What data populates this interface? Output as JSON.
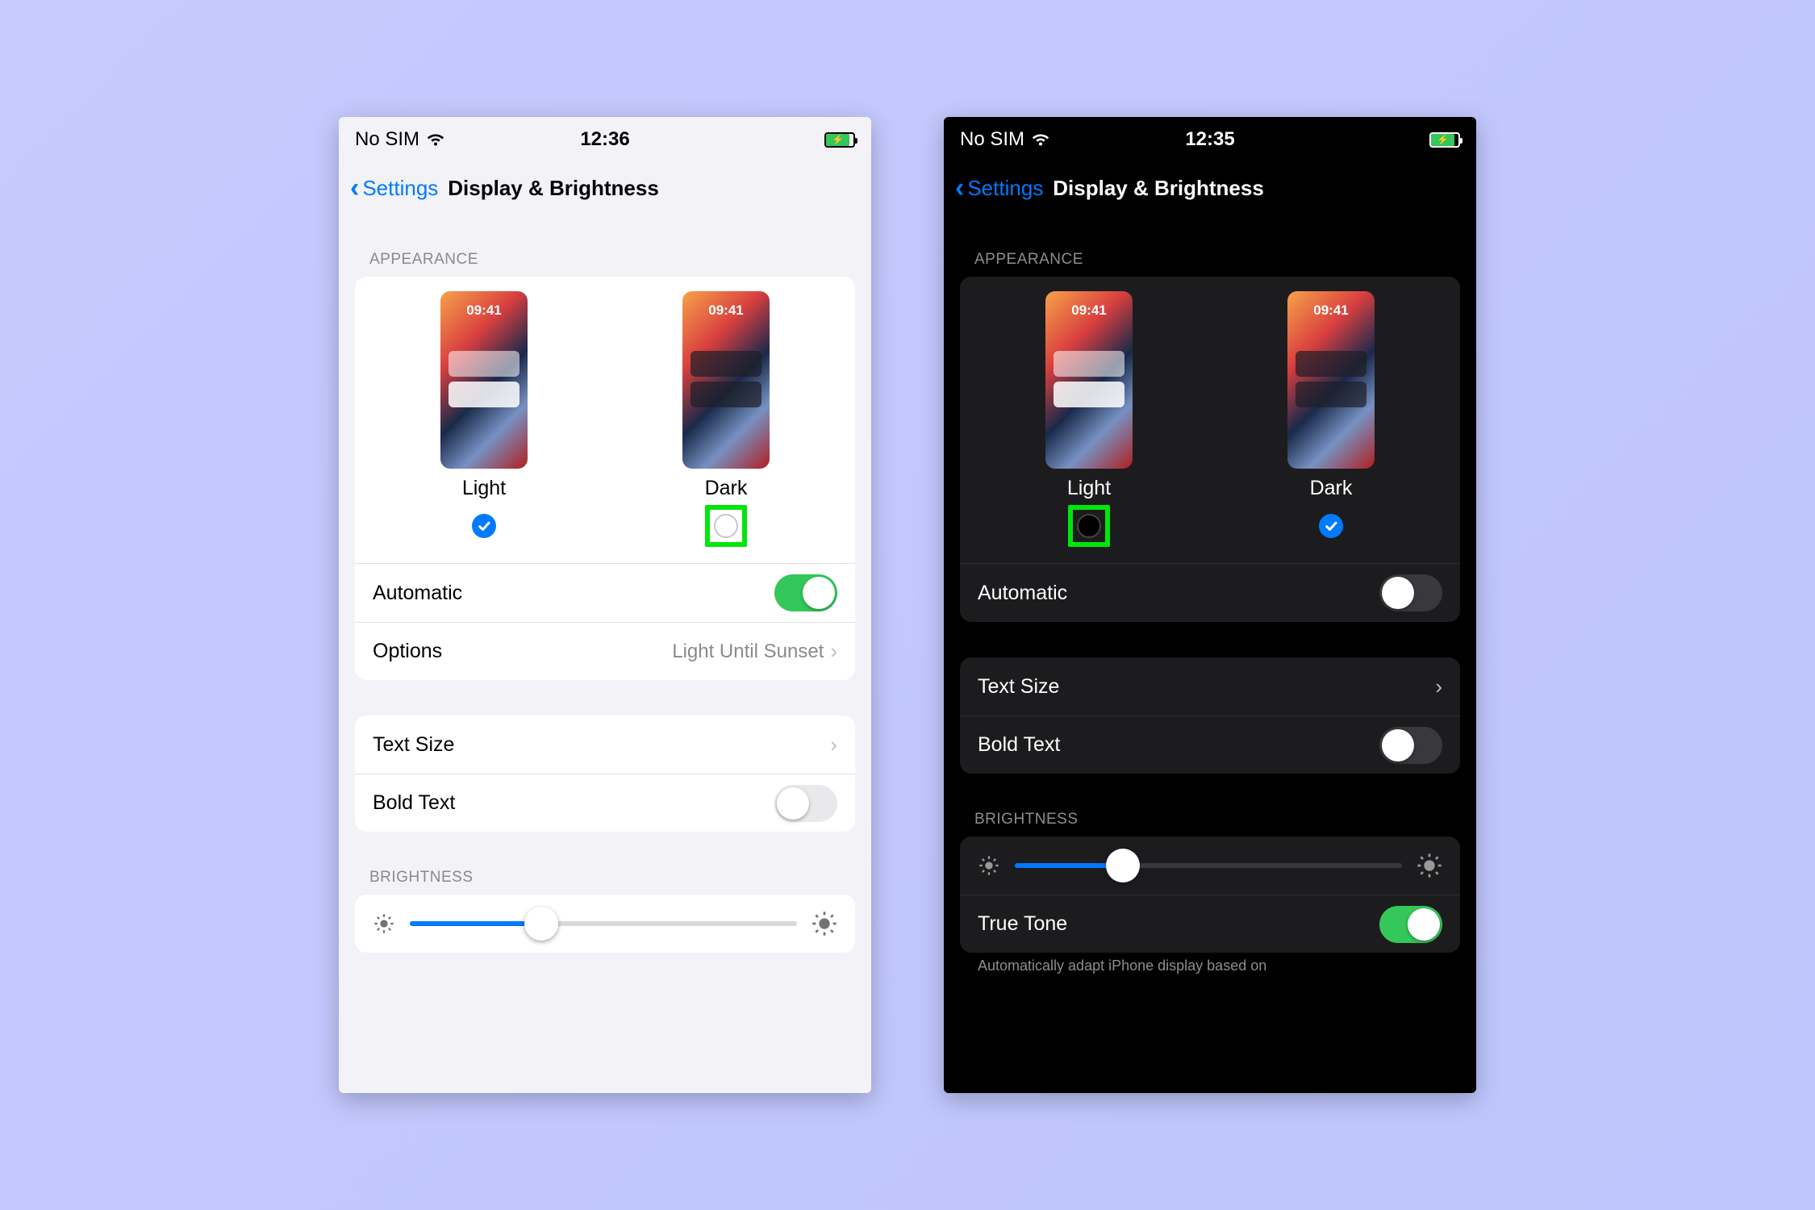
{
  "left": {
    "status": {
      "carrier": "No SIM",
      "time": "12:36"
    },
    "nav": {
      "back": "Settings",
      "title": "Display & Brightness"
    },
    "appearance": {
      "label": "APPEARANCE",
      "preview_time": "09:41",
      "light_label": "Light",
      "dark_label": "Dark",
      "selected": "light",
      "highlight": "dark"
    },
    "automatic": {
      "label": "Automatic",
      "on": true
    },
    "options": {
      "label": "Options",
      "value": "Light Until Sunset"
    },
    "text_size": {
      "label": "Text Size"
    },
    "bold_text": {
      "label": "Bold Text",
      "on": false
    },
    "brightness": {
      "label": "BRIGHTNESS",
      "value_pct": 34
    }
  },
  "right": {
    "status": {
      "carrier": "No SIM",
      "time": "12:35"
    },
    "nav": {
      "back": "Settings",
      "title": "Display & Brightness"
    },
    "appearance": {
      "label": "APPEARANCE",
      "preview_time": "09:41",
      "light_label": "Light",
      "dark_label": "Dark",
      "selected": "dark",
      "highlight": "light"
    },
    "automatic": {
      "label": "Automatic",
      "on": false
    },
    "text_size": {
      "label": "Text Size"
    },
    "bold_text": {
      "label": "Bold Text",
      "on": false
    },
    "brightness": {
      "label": "BRIGHTNESS",
      "value_pct": 28
    },
    "true_tone": {
      "label": "True Tone",
      "on": true
    },
    "footer": "Automatically adapt iPhone display based on"
  }
}
